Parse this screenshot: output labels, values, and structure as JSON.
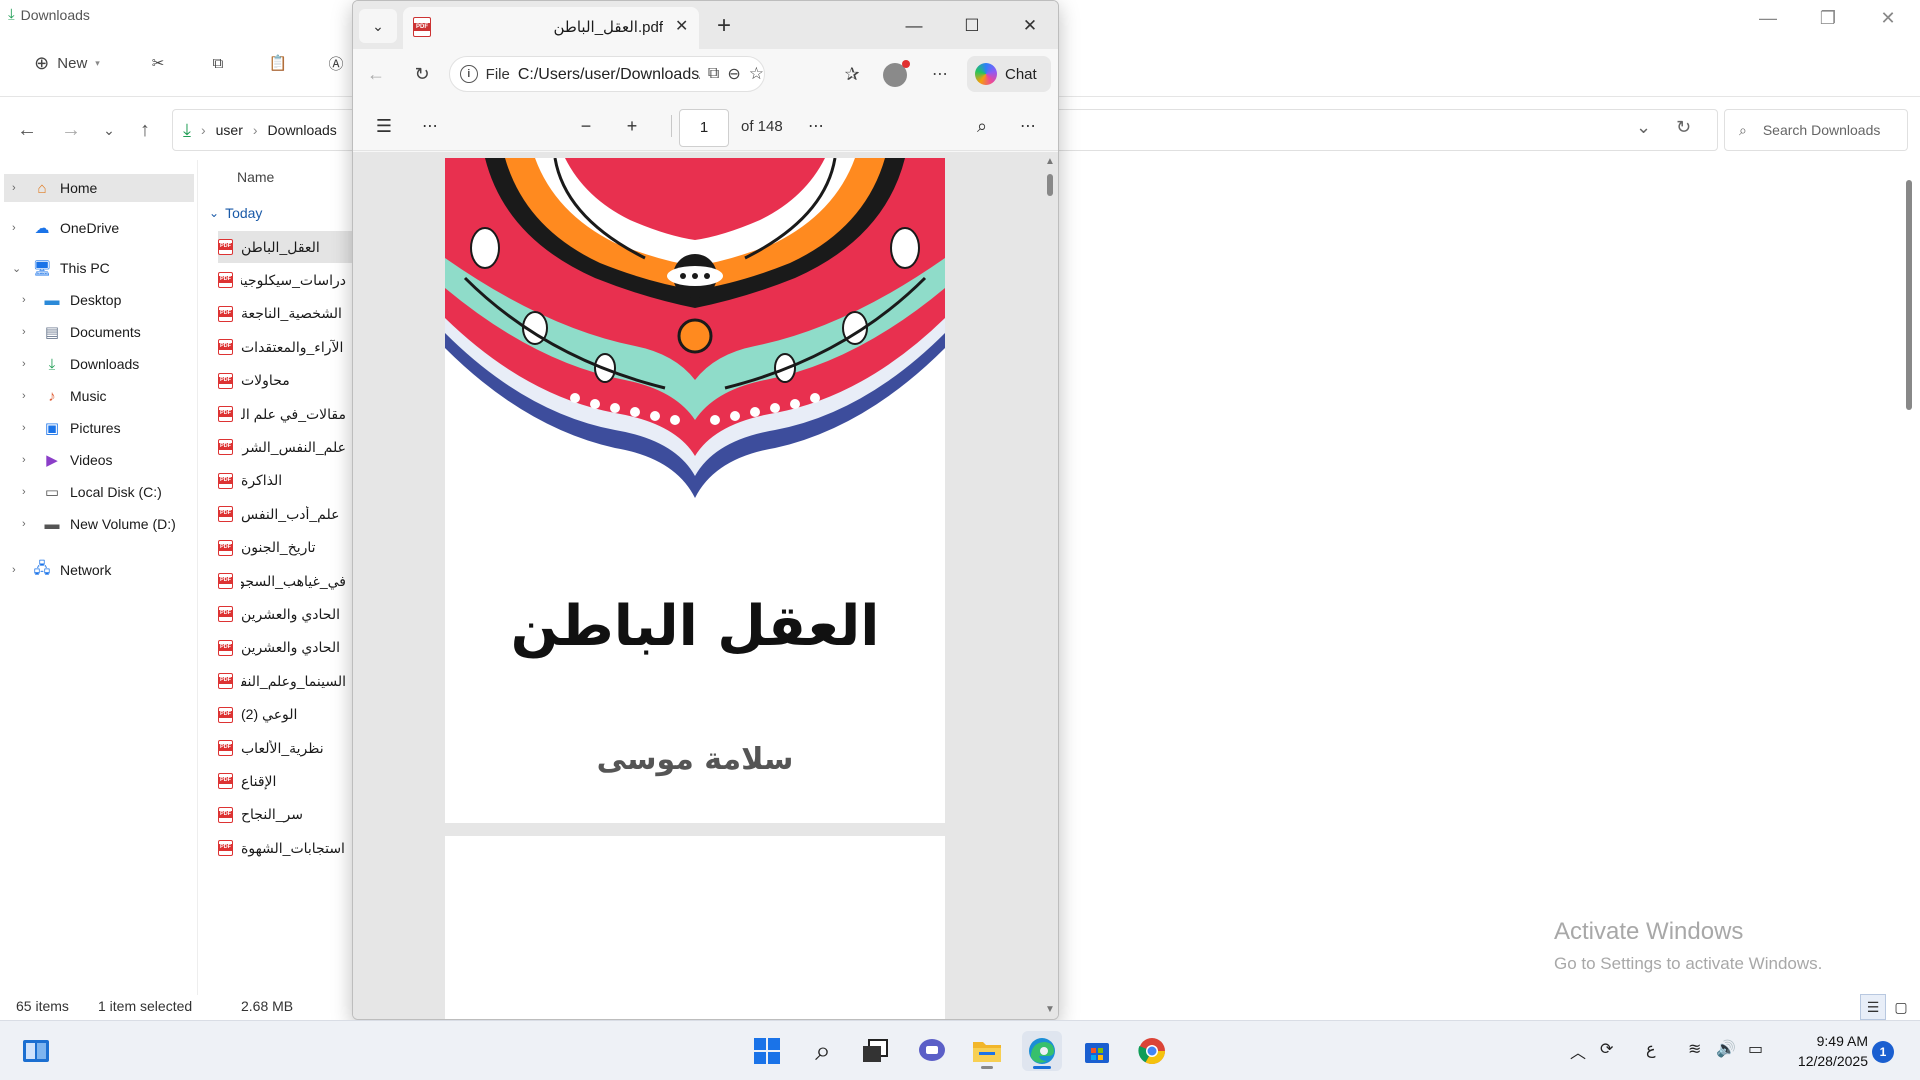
{
  "explorer": {
    "window_title": "Downloads",
    "toolbar": {
      "new_label": "New"
    },
    "breadcrumb": [
      "user",
      "Downloads"
    ],
    "search_placeholder": "Search Downloads",
    "column_name": "Name",
    "group_label": "Today",
    "sidebar": {
      "home": "Home",
      "onedrive": "OneDrive",
      "this_pc": "This PC",
      "desktop": "Desktop",
      "documents": "Documents",
      "downloads": "Downloads",
      "music": "Music",
      "pictures": "Pictures",
      "videos": "Videos",
      "local_disk": "Local Disk (C:)",
      "new_volume": "New Volume (D:)",
      "network": "Network"
    },
    "files": [
      "العقل_الباطن",
      "دراسات_سيكلوجية",
      "الشخصية_الناجعة",
      "الآراء_والمعتقدات",
      "محاولات",
      "مقالات_في علم النفس",
      "علم_النفس_الشرعي",
      "الذاكرة",
      "علم_أدب_النفس",
      "تاريخ_الجنون",
      "في_غياهب_السجون",
      "الحادي والعشرين",
      "الحادي والعشرين",
      "السينما_وعلم_النفس",
      "الوعي (2)",
      "نظرية_الألعاب",
      "الإقناع",
      "سر_النجاح",
      "استجابات_الشهوة"
    ],
    "status": {
      "items": "65 items",
      "selected": "1 item selected",
      "size": "2.68 MB"
    },
    "activate_title": "Activate Windows",
    "activate_sub": "Go to Settings to activate Windows."
  },
  "edge": {
    "tab_title": "العقل_الباطن.pdf",
    "url_scheme": "File",
    "url_path": "C:/Users/user/Downloads/العقل_الباطن.pdf",
    "copilot_label": "Chat",
    "page_current": "1",
    "page_total": "of 148",
    "book_title": "العقل الباطن",
    "book_author": "سلامة موسى"
  },
  "taskbar": {
    "time": "9:49 AM",
    "date": "12/28/2025",
    "notifications": "1",
    "lang": "ع"
  }
}
